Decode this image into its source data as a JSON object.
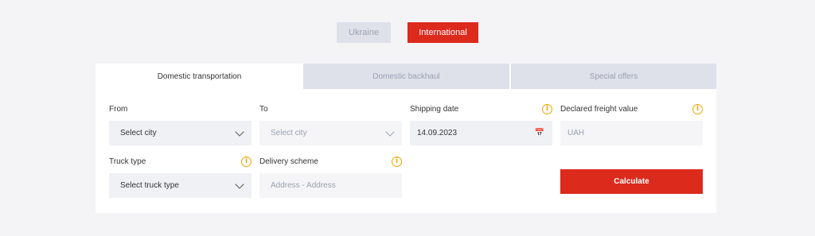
{
  "regions": [
    "Ukraine",
    "International"
  ],
  "tabs": [
    "Domestic transportation",
    "Domestic backhaul",
    "Special offers"
  ],
  "form": {
    "from": {
      "label": "From",
      "placeholder": "Select city"
    },
    "to": {
      "label": "To",
      "placeholder": "Select city"
    },
    "shipping_date": {
      "label": "Shipping date",
      "value": "14.09.2023"
    },
    "declared_value": {
      "label": "Declared freight value",
      "placeholder": "UAH"
    },
    "truck_type": {
      "label": "Truck type",
      "placeholder": "Select truck type"
    },
    "delivery_scheme": {
      "label": "Delivery scheme",
      "placeholder": "Address - Address"
    }
  },
  "calculate_label": "Calculate",
  "icons": {
    "info": "info-icon",
    "calendar": "calendar-icon",
    "chevron": "chevron-down-icon"
  },
  "colors": {
    "accent": "#dc2a1d",
    "info": "#f0a500",
    "tab_inactive": "#dee1ea"
  }
}
